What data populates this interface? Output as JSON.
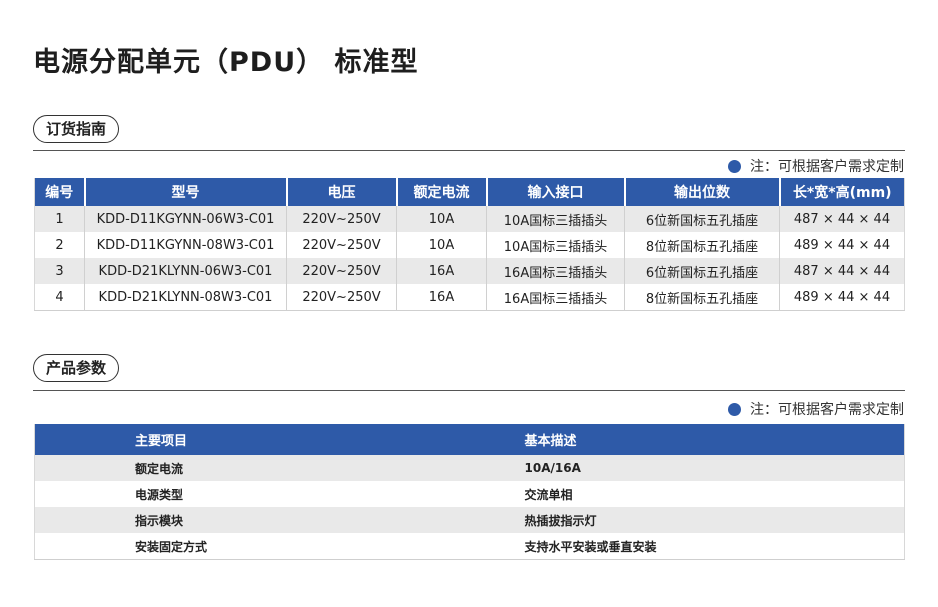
{
  "title": "电源分配单元（PDU） 标准型",
  "ordering": {
    "heading": "订货指南",
    "note": "注：可根据客户需求定制",
    "columns": [
      "编号",
      "型号",
      "电压",
      "额定电流",
      "输入接口",
      "输出位数",
      "长*宽*高(mm)"
    ],
    "rows": [
      [
        "1",
        "KDD-D11KGYNN-06W3-C01",
        "220V~250V",
        "10A",
        "10A国标三插插头",
        "6位新国标五孔插座",
        "487 × 44 × 44"
      ],
      [
        "2",
        "KDD-D11KGYNN-08W3-C01",
        "220V~250V",
        "10A",
        "10A国标三插插头",
        "8位新国标五孔插座",
        "489 × 44 × 44"
      ],
      [
        "3",
        "KDD-D21KLYNN-06W3-C01",
        "220V~250V",
        "16A",
        "16A国标三插插头",
        "6位新国标五孔插座",
        "487 × 44 × 44"
      ],
      [
        "4",
        "KDD-D21KLYNN-08W3-C01",
        "220V~250V",
        "16A",
        "16A国标三插插头",
        "8位新国标五孔插座",
        "489 × 44 × 44"
      ]
    ]
  },
  "params": {
    "heading": "产品参数",
    "note": "注：可根据客户需求定制",
    "columns": [
      "主要项目",
      "基本描述"
    ],
    "rows": [
      [
        "额定电流",
        "10A/16A"
      ],
      [
        "电源类型",
        "交流单相"
      ],
      [
        "指示模块",
        "热插拔指示灯"
      ],
      [
        "安装固定方式",
        "支持水平安装或垂直安装"
      ]
    ]
  },
  "colors": {
    "header_blue": "#2e5aa8",
    "stripe_gray": "#e9e9e9"
  }
}
